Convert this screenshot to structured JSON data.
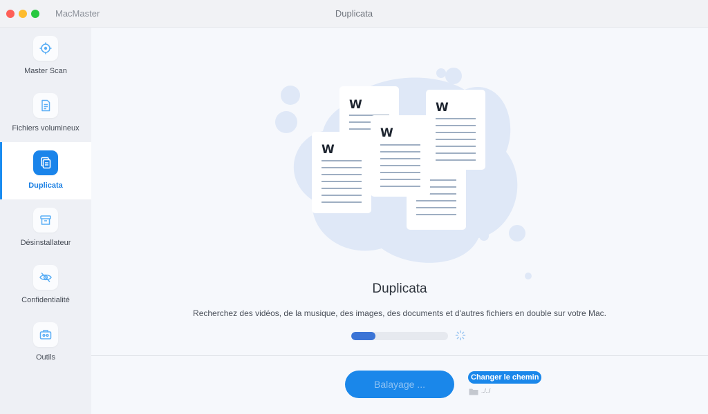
{
  "window": {
    "app_name": "MacMaster",
    "title": "Duplicata"
  },
  "sidebar": {
    "items": [
      {
        "label": "Master Scan",
        "icon": "target-icon"
      },
      {
        "label": "Fichiers volumineux",
        "icon": "document-icon"
      },
      {
        "label": "Duplicata",
        "icon": "duplicate-files-icon",
        "active": true
      },
      {
        "label": "Désinstallateur",
        "icon": "box-icon"
      },
      {
        "label": "Confidentialité",
        "icon": "eye-off-icon"
      },
      {
        "label": "Outils",
        "icon": "toolbox-icon"
      }
    ]
  },
  "main": {
    "heading": "Duplicata",
    "description": "Recherchez des vidéos, de la musique, des images, des documents et d'autres fichiers en double sur votre Mac.",
    "progress_fraction": 0.25,
    "scan_button_label": "Balayage ...",
    "change_path_label": "Changer le chemin",
    "path_value": "../../"
  },
  "colors": {
    "accent": "#1a87ea",
    "progress": "#3b74d6",
    "sidebar_bg": "#eef0f5",
    "main_bg": "#f6f8fc"
  }
}
